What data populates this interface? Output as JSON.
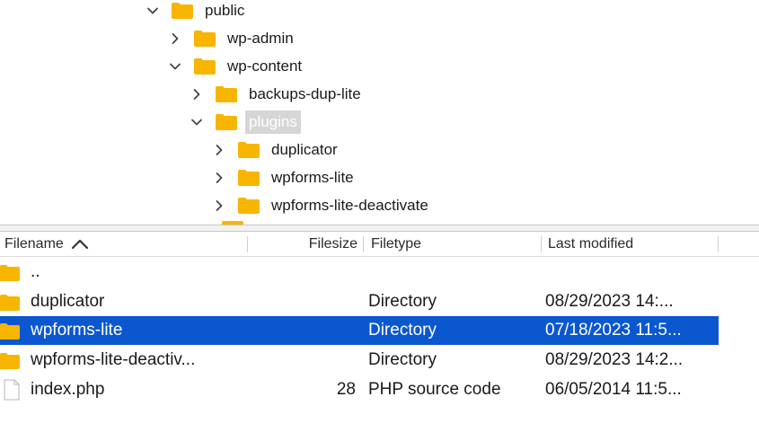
{
  "tree": {
    "items": [
      {
        "label": "public",
        "chevron": "down"
      },
      {
        "label": "wp-admin",
        "chevron": "right"
      },
      {
        "label": "wp-content",
        "chevron": "down"
      },
      {
        "label": "backups-dup-lite",
        "chevron": "right"
      },
      {
        "label": "plugins",
        "chevron": "down",
        "selected": true
      },
      {
        "label": "duplicator",
        "chevron": "right"
      },
      {
        "label": "wpforms-lite",
        "chevron": "right"
      },
      {
        "label": "wpforms-lite-deactivate",
        "chevron": "right"
      }
    ]
  },
  "list": {
    "columns": {
      "filename": "Filename",
      "filesize": "Filesize",
      "filetype": "Filetype",
      "last_modified": "Last modified"
    },
    "sort_icon": "chevron-up-icon",
    "rows": [
      {
        "name": "..",
        "size": "",
        "type": "",
        "modified": "",
        "icon": "folder-icon"
      },
      {
        "name": "duplicator",
        "size": "",
        "type": "Directory",
        "modified": "08/29/2023 14:...",
        "icon": "folder-icon"
      },
      {
        "name": "wpforms-lite",
        "size": "",
        "type": "Directory",
        "modified": "07/18/2023 11:5...",
        "icon": "folder-icon",
        "selected": true
      },
      {
        "name": "wpforms-lite-deactiv...",
        "size": "",
        "type": "Directory",
        "modified": "08/29/2023 14:2...",
        "icon": "folder-icon"
      },
      {
        "name": "index.php",
        "size": "28",
        "type": "PHP source code",
        "modified": "06/05/2014 11:5...",
        "icon": "file-icon"
      }
    ]
  },
  "colors": {
    "folder": "#f7b500",
    "selection": "#0b57d0",
    "tree_selection": "#d6d6d6"
  }
}
